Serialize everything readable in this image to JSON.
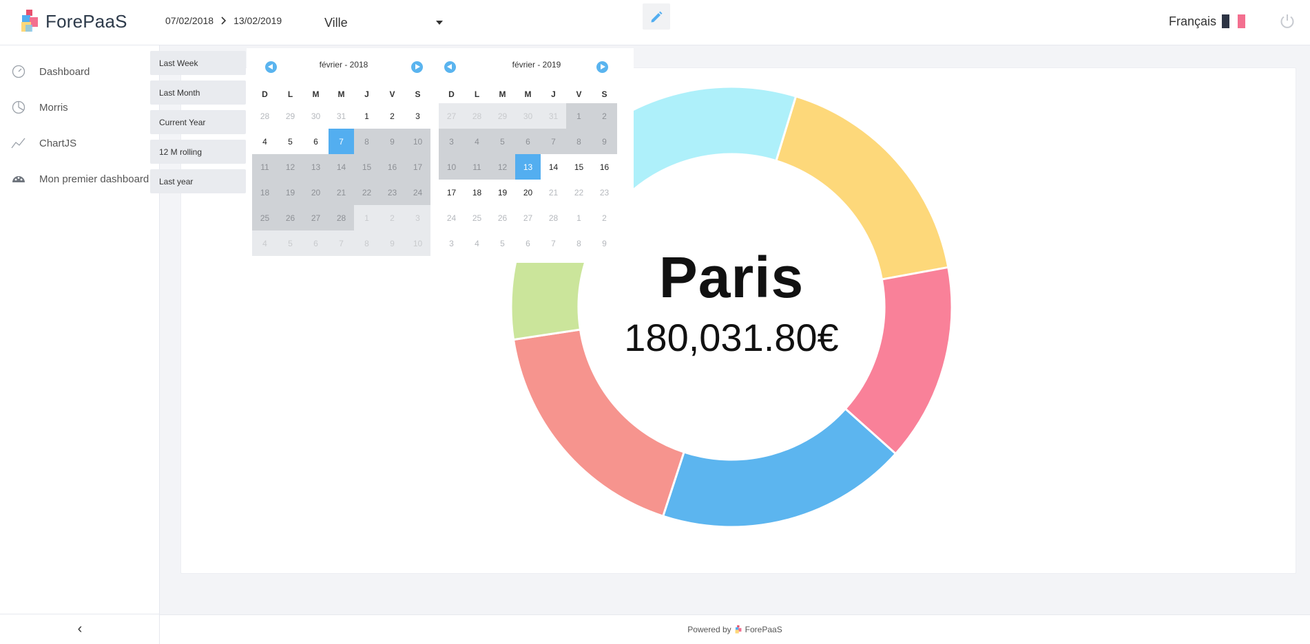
{
  "header": {
    "brand": "ForePaaS",
    "date_start": "07/02/2018",
    "date_end": "13/02/2019",
    "filter_label": "Ville",
    "language": "Français"
  },
  "sidebar": {
    "items": [
      {
        "label": "Dashboard",
        "icon": "gauge-icon"
      },
      {
        "label": "Morris",
        "icon": "pie-icon"
      },
      {
        "label": "ChartJS",
        "icon": "line-chart-icon"
      },
      {
        "label": "Mon premier dashboard",
        "icon": "palette-icon"
      }
    ],
    "collapse": "‹"
  },
  "datepicker": {
    "presets": [
      "Last Week",
      "Last Month",
      "Current Year",
      "12 M rolling",
      "Last year"
    ],
    "weekdays": [
      "D",
      "L",
      "M",
      "M",
      "J",
      "V",
      "S"
    ],
    "left": {
      "title": "février - 2018",
      "days": [
        "28",
        "29",
        "30",
        "31",
        "1",
        "2",
        "3",
        "4",
        "5",
        "6",
        "7",
        "8",
        "9",
        "10",
        "11",
        "12",
        "13",
        "14",
        "15",
        "16",
        "17",
        "18",
        "19",
        "20",
        "21",
        "22",
        "23",
        "24",
        "25",
        "26",
        "27",
        "28",
        "1",
        "2",
        "3",
        "4",
        "5",
        "6",
        "7",
        "8",
        "9",
        "10"
      ],
      "states": [
        "m",
        "m",
        "m",
        "m",
        "n",
        "n",
        "n",
        "n",
        "n",
        "n",
        "s",
        "r",
        "r",
        "r",
        "r",
        "r",
        "r",
        "r",
        "r",
        "r",
        "r",
        "r",
        "r",
        "r",
        "r",
        "r",
        "r",
        "r",
        "r",
        "r",
        "r",
        "r",
        "g",
        "g",
        "g",
        "g",
        "g",
        "g",
        "g",
        "g",
        "g",
        "g"
      ]
    },
    "right": {
      "title": "février - 2019",
      "days": [
        "27",
        "28",
        "29",
        "30",
        "31",
        "1",
        "2",
        "3",
        "4",
        "5",
        "6",
        "7",
        "8",
        "9",
        "10",
        "11",
        "12",
        "13",
        "14",
        "15",
        "16",
        "17",
        "18",
        "19",
        "20",
        "21",
        "22",
        "23",
        "24",
        "25",
        "26",
        "27",
        "28",
        "1",
        "2",
        "3",
        "4",
        "5",
        "6",
        "7",
        "8",
        "9"
      ],
      "states": [
        "g",
        "g",
        "g",
        "g",
        "g",
        "r",
        "r",
        "r",
        "r",
        "r",
        "r",
        "r",
        "r",
        "r",
        "r",
        "r",
        "r",
        "s",
        "n",
        "n",
        "n",
        "n",
        "n",
        "n",
        "n",
        "m",
        "m",
        "m",
        "m",
        "m",
        "m",
        "m",
        "m",
        "m",
        "m",
        "m",
        "m",
        "m",
        "m",
        "m",
        "m",
        "m"
      ]
    }
  },
  "chart_data": {
    "type": "pie",
    "donut": true,
    "center_title": "Paris",
    "center_value": "180,031.80€",
    "colors": [
      "#fdd87a",
      "#f98199",
      "#5cb5ef",
      "#f6948e",
      "#cbe59b",
      "#aef0fa"
    ],
    "values": [
      17.4,
      14.5,
      18.4,
      17.6,
      15.2,
      16.9
    ],
    "partial_ring_visible": true
  },
  "footer": {
    "powered_by": "Powered by",
    "brand": "ForePaaS"
  }
}
